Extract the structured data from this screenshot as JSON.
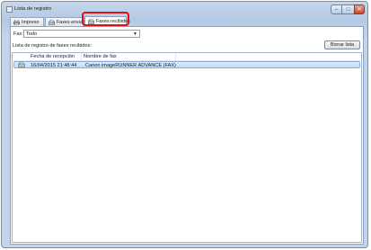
{
  "window": {
    "title": "Lista de registro",
    "controls": [
      "minimize-icon",
      "maximize-icon",
      "close-icon"
    ]
  },
  "tabs": [
    {
      "label": "Impreso",
      "icon": "printer-icon",
      "selected": false
    },
    {
      "label": "Faxes enviados",
      "icon": "fax-sent-icon",
      "selected": false
    },
    {
      "label": "Faxes recibidos",
      "icon": "fax-received-icon",
      "selected": true
    }
  ],
  "filter": {
    "label": "Fax:",
    "value": "Todo"
  },
  "list": {
    "caption": "Lista de registro de faxes recibidos:",
    "clear_button": "Borrar lista",
    "columns": [
      "Fecha de recepción",
      "Nombre de fax"
    ],
    "rows": [
      {
        "date": "16/04/2015 21:48:44",
        "name": "Canon imageRUNNER ADVANCE (FAX)",
        "icon": "fax-received-icon",
        "selected": true
      }
    ]
  },
  "colors": {
    "highlight": "#e0101a",
    "selection": "#c4dcf6",
    "titlebar": "#b4c9e4"
  }
}
